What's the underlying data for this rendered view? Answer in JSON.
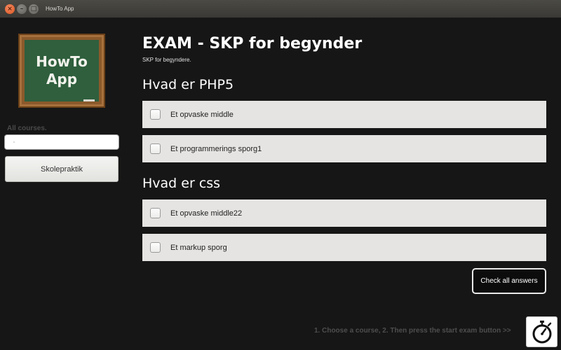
{
  "window": {
    "title": "HowTo App",
    "close_glyph": "×",
    "minimize_glyph": "–",
    "maximize_glyph": "□"
  },
  "sidebar": {
    "logo": {
      "line1": "HowTo",
      "line2": "App"
    },
    "courses_label": "All courses.",
    "search": {
      "value": "",
      "placeholder": "",
      "icon": "search-icon"
    },
    "courses": [
      {
        "label": "Skolepraktik"
      }
    ]
  },
  "exam": {
    "title": "EXAM - SKP for begynder",
    "subtitle": "SKP for begyndere.",
    "questions": [
      {
        "title": "Hvad er PHP5",
        "answers": [
          {
            "label": "Et opvaske middle",
            "checked": false
          },
          {
            "label": "Et programmerings sporg1",
            "checked": false
          }
        ]
      },
      {
        "title": "Hvad er css",
        "answers": [
          {
            "label": "Et opvaske middle22",
            "checked": false
          },
          {
            "label": "Et markup sporg",
            "checked": false
          }
        ]
      }
    ],
    "check_button_label": "Check all answers"
  },
  "footer": {
    "hint": "1. Choose a course, 2. Then press the start exam button >>",
    "timer_icon": "stopwatch-icon"
  },
  "colors": {
    "background": "#161616",
    "answer_row": "#e5e4e2",
    "close_button": "#d9541f",
    "chalkboard": "#2f5f3d",
    "frame": "#8b5a2b"
  }
}
